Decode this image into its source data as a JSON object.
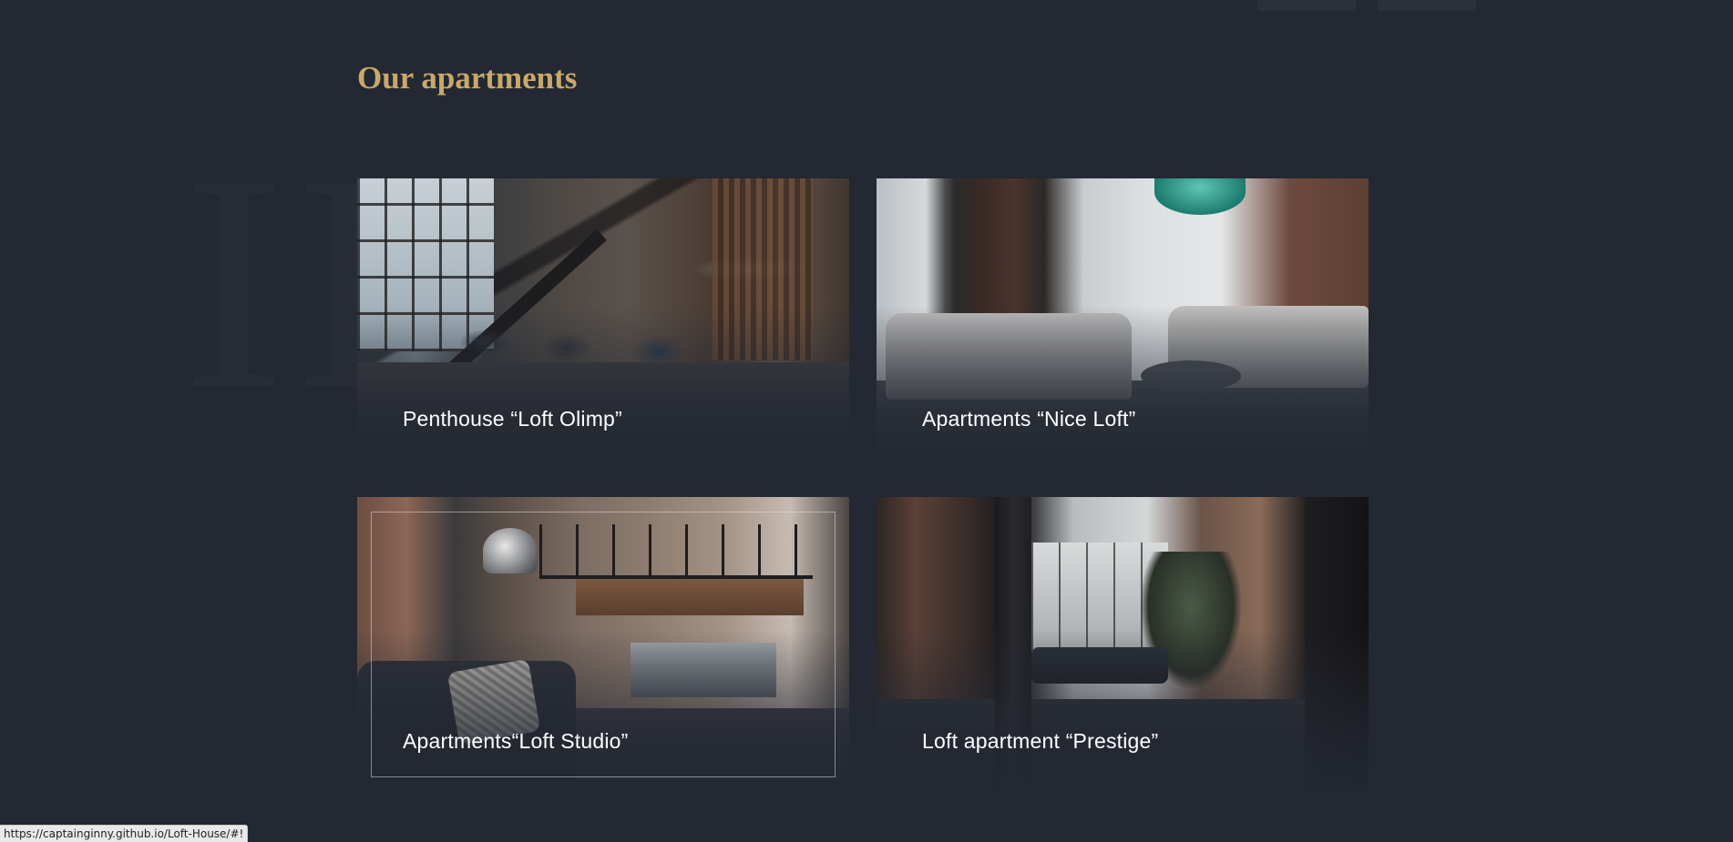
{
  "section": {
    "title": "Our apartments",
    "watermark": "III"
  },
  "apartments": [
    {
      "name": "Penthouse “Loft Olimp”"
    },
    {
      "name": "Apartments “Nice Loft”"
    },
    {
      "name": "Apartments“Loft Studio”"
    },
    {
      "name": "Loft apartment “Prestige”"
    }
  ],
  "status_bar": {
    "url": "https://captainginny.github.io/Loft-House/#!"
  },
  "colors": {
    "background": "#232832",
    "accent": "#c9a86a",
    "label": "#ffffff"
  }
}
